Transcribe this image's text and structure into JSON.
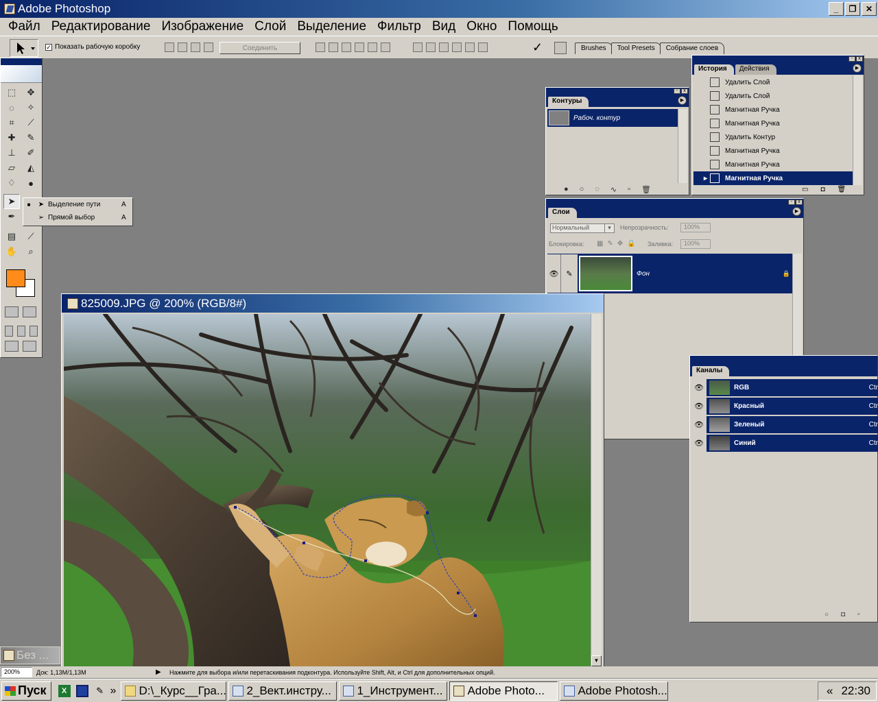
{
  "app": {
    "title": "Adobe Photoshop"
  },
  "menu": [
    "Файл",
    "Редактирование",
    "Изображение",
    "Слой",
    "Выделение",
    "Фильтр",
    "Вид",
    "Окно",
    "Помощь"
  ],
  "options": {
    "show_bbox": "Показать рабочую коробку",
    "combine": "Соединить",
    "checkmark": "✓"
  },
  "well_tabs": [
    "Brushes",
    "Tool Presets",
    "Собрание слоев"
  ],
  "flyout": [
    {
      "label": "Выделение пути",
      "key": "A"
    },
    {
      "label": "Прямой выбор",
      "key": "A"
    }
  ],
  "paths_panel": {
    "tab": "Контуры",
    "item": "Рабоч. контур"
  },
  "history_panel": {
    "tab_active": "История",
    "tab_other": "Действия",
    "items": [
      "Удалить Слой",
      "Удалить Слой",
      "Магнитная Ручка",
      "Магнитная Ручка",
      "Удалить Контур",
      "Магнитная Ручка",
      "Магнитная Ручка",
      "Магнитная Ручка"
    ]
  },
  "layers_panel": {
    "tab": "Слои",
    "blend": "Нормальный",
    "opacity_label": "Непрозрачность:",
    "opacity": "100%",
    "lock_label": "Блокировка:",
    "fill_label": "Заливка:",
    "fill": "100%",
    "layer_name": "Фон"
  },
  "channels_panel": {
    "tab": "Каналы",
    "items": [
      "RGB",
      "Красный",
      "Зеленый",
      "Синий"
    ],
    "shortcut": "Ctr"
  },
  "document": {
    "title": "825009.JPG @ 200% (RGB/8#)"
  },
  "minimized": {
    "label": "Без ..."
  },
  "status": {
    "zoom": "200%",
    "doc": "Док: 1,13M/1,13M",
    "hint": "Нажмите для выбора и/или перетаскивания подконтура.  Используйте Shift, Alt, и Ctrl для дополнительных опций."
  },
  "taskbar": {
    "start": "Пуск",
    "more": "»",
    "buttons": [
      "D:\\_Курс__Гра...",
      "2_Вект.инстру...",
      "1_Инструмент...",
      "Adobe Photo...",
      "Adobe Photosh..."
    ],
    "tray_arrow": "«",
    "clock": "22:30"
  },
  "colors": {
    "foreground": "#ff8c1a",
    "background": "#ffffff",
    "selection": "#0a246a"
  }
}
